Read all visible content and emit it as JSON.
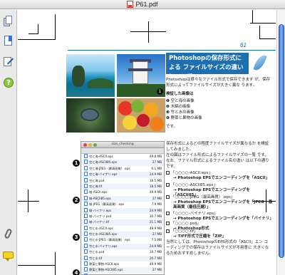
{
  "window": {
    "title": "P61.pdf"
  },
  "sidebar": {
    "icons": [
      "pages-icon",
      "document-bookmark-icon",
      "edit-pencil-icon",
      "help-icon",
      "attachment-paperclip-icon",
      "comment-bubble-icon"
    ]
  },
  "page": {
    "number": "61",
    "heading": "Photoshopの保存形式による ファイルサイズの違いについて",
    "intro": "Photoshopは様々なファイル形式で保存できます が、保存形式によってファイルサイズが大きく異な ります。",
    "subhead": "検証した画像は",
    "list": [
      "❶ 空と海の画像",
      "❷ 木綿の画像",
      "❸ 竹と水の画像",
      "❹ 野菜と果物の画像"
    ],
    "list_end": "です。",
    "mid_text": "保存形式によるどの程度ファイルサイズが異なるか を検証してみました。",
    "mid_text2": "左の図はファイル形式によるファイルサイズの一覧 です。なお、ファイル形式によるファイル名の違い は以下の通りです。",
    "items": [
      {
        "title": "「○○○○-ASCII.eps」",
        "desc": "→ Photoshop EPSでエンコーディングを「ASCII」"
      },
      {
        "title": "「○○○○-ASCII85.eps」",
        "desc": "→ Photoshop EPSでエンコーディングを「ASCII85」"
      },
      {
        "title": "「○○○○-JPEG（最高画質）.eps」",
        "desc": "→ Photoshop EPSでエンコーディングを「JPEG - 最高画質（最低圧縮）」"
      },
      {
        "title": "「○○○○-バイナリ.eps」",
        "desc": "→ Photoshop EPSでエンコーディングを「バイナリ」"
      },
      {
        "title": "「○○○○.psd」",
        "desc": "→ Photoshop形式"
      },
      {
        "title": "「○○○○.tif」",
        "desc": "→ TIFF形式で圧縮を「ZIP」"
      }
    ],
    "footer": "当然としては、PhotoshopのEPS形式の「ASCII」エン コーディングでの保存はファイルサイズが不用意に 大きくなるためおすすめしません。"
  },
  "finder": {
    "title": "size_checking",
    "files": [
      {
        "name": "空と海-ASCII.eps",
        "size": "49.8 MB"
      },
      {
        "name": "空と海-ASCII85.eps",
        "size": "27 MB"
      },
      {
        "name": "空と海-JPEG（最高画質）.eps",
        "size": "6.1 MB"
      },
      {
        "name": "空と海-バイナリ.eps",
        "size": "24.9 MB"
      },
      {
        "name": "空と海.psd",
        "size": "18.5 MB"
      },
      {
        "name": "空と海.tif",
        "size": "18.5 MB"
      },
      {
        "name": "城-ASCII.eps",
        "size": "49.9 MB"
      },
      {
        "name": "城-ASCII85.eps",
        "size": "27 MB"
      },
      {
        "name": "城-JPEG（最高画質）.eps",
        "size": "7.9 MB"
      },
      {
        "name": "城-バイナリ.eps",
        "size": "24.9 MB"
      },
      {
        "name": "城-バイナリ.psd",
        "size": "30.7 MB"
      },
      {
        "name": "城-バイナリ.tif",
        "size": "21.1 MB"
      },
      {
        "name": "竹と水-ASCII.eps",
        "size": "49.9 MB"
      },
      {
        "name": "竹と水-ASCII85.eps",
        "size": "27 MB"
      },
      {
        "name": "竹と水-JPEG（最高画質）.eps",
        "size": "7.5 MB"
      },
      {
        "name": "竹と水-バイナリ.eps",
        "size": "24.9 MB"
      },
      {
        "name": "竹と水.psd",
        "size": "19.7 MB"
      },
      {
        "name": "竹と水.tif",
        "size": "20.7 MB"
      },
      {
        "name": "野菜と果物-ASCII.eps",
        "size": "49.9 MB"
      },
      {
        "name": "野菜と果物-ASCII85.eps",
        "size": "27 MB"
      },
      {
        "name": "野菜と果物-JPEG（最高画質）.eps",
        "size": "5.6 MB"
      }
    ]
  },
  "markers": [
    "1",
    "2",
    "3",
    "4"
  ],
  "photo_badge": "1",
  "colors": {
    "accent": "#1d6fb0",
    "scroll_thumb": "#3b6fd4"
  }
}
